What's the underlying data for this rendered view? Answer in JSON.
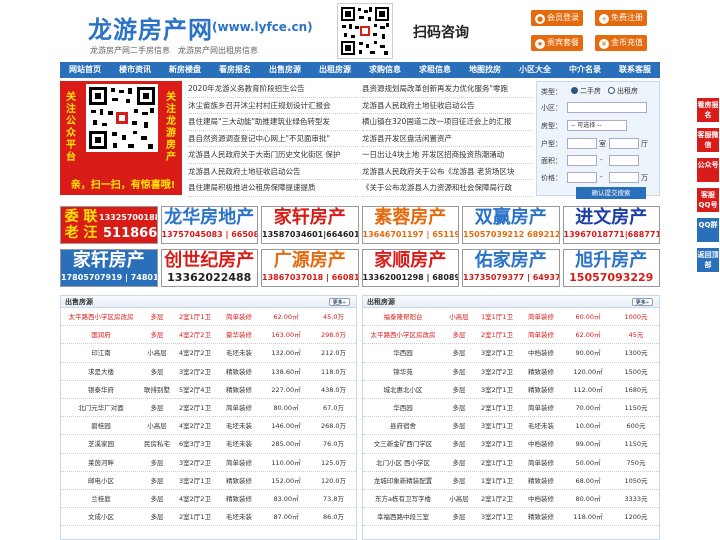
{
  "header": {
    "logo_title": "龙游房产网",
    "logo_url": "(www.lyfce.cn)",
    "logo_sub": "龙游房产网二手房信息　龙游房产网出租房信息",
    "scan_text": "扫码咨询",
    "buttons": [
      "会员登录",
      "免费注册",
      "贵宾套餐",
      "金币充值"
    ]
  },
  "nav": [
    "网站首页",
    "楼市资讯",
    "新房楼盘",
    "看房报名",
    "出售房源",
    "出租房源",
    "求购信息",
    "求租信息",
    "地图找房",
    "小区大全",
    "中介名录",
    "联系客服"
  ],
  "left_qr": {
    "vertical_text": "关注公众平台",
    "vertical_text_right": "关注龙游房产",
    "slogan": "亲，扫一扫，有惊喜哦!"
  },
  "news_left": [
    "2020年龙游义务教育阶段招生公告",
    "沐尘畲族乡召开沐尘村村庄规划设计汇报会",
    "县住建局\"三大动能\"助推建筑业绿色转型发",
    "县自然资源调查登记中心网上\"不见面审批\"",
    "龙游县人民政府关于大南门历史文化街区 保护",
    "龙游县人民政府土地征收启动公告",
    "县住建局积极推进公租房保障提速提质"
  ],
  "news_right": [
    "县资源规划局改革创新再发力优化服务\"零跑",
    "龙游县人民政府土地征收启动公告",
    "横山镇在320国道二改一项目征迁会上的汇报",
    "龙游县开发区盘活闲置资产",
    "一日出让4块土地 开发区招商投资热潮涌动",
    "龙游县人民政府关于公布《龙游县 老货场区块",
    "《关于公布龙游县人力资源和社会保障局行政"
  ],
  "search": {
    "type_label": "类型：",
    "opt1": "二手房",
    "opt2": "出租房",
    "xiaoqu": "小区：",
    "fangxing": "房型：",
    "fangxing_val": "-- 可选择 --",
    "huxing": "户型：",
    "shi": "室",
    "ting": "厅",
    "mianji": "面积：",
    "price": "价格：",
    "unit": "万",
    "submit": "确认提交搜索"
  },
  "ads": [
    {
      "title": "委 联\n老 汪",
      "phone": "13325700188",
      "phone2": "511866"
    },
    {
      "title": "龙华房地产",
      "phone": "13757045083 | 665083"
    },
    {
      "title": "家轩房产",
      "phone": "13587034601|664601"
    },
    {
      "title": "素蓉房产",
      "phone": "13646701197 | 651197"
    },
    {
      "title": "双赢房产",
      "phone": "15057039212 689212"
    },
    {
      "title": "进文房产",
      "phone": "13967018771|688771"
    },
    {
      "title": "家轩房产",
      "phone": "17805707919 | 748019"
    },
    {
      "title": "创世纪房产",
      "phone": "13362022488"
    },
    {
      "title": "广源房产",
      "phone": "13867037018 | 660818"
    },
    {
      "title": "家顺房产",
      "phone": "13362001298 | 680890"
    },
    {
      "title": "佑家房产",
      "phone": "13735079377 | 649377"
    },
    {
      "title": "旭升房产",
      "phone": "15057093229"
    }
  ],
  "sidebar": [
    "看房报名",
    "客服微信",
    "公众号",
    "客服QQ号",
    "QQ群",
    "返回顶部"
  ],
  "sale": {
    "title": "出售房源",
    "more": "更多»",
    "rows": [
      [
        "太平路西小学区房改房",
        "多层",
        "2室1厅1卫",
        "简单装修",
        "62.00㎡",
        "45.0万"
      ],
      [
        "国润府",
        "多层",
        "4室2厅2卫",
        "豪华装修",
        "163.00㎡",
        "298.0万"
      ],
      [
        "印江南",
        "小高层",
        "4室2厅2卫",
        "毛坯未装",
        "132.00㎡",
        "212.0万"
      ],
      [
        "求是大楼",
        "多层",
        "3室2厅2卫",
        "精致装修",
        "138.60㎡",
        "118.0万"
      ],
      [
        "银泰华府",
        "联排别墅",
        "5室2厅4卫",
        "精致装修",
        "227.00㎡",
        "438.0万"
      ],
      [
        "北门元华厂对面",
        "多层",
        "2室2厅1卫",
        "简单装修",
        "80.00㎡",
        "67.0万"
      ],
      [
        "碧桂园",
        "小高层",
        "4室2厅2卫",
        "毛坯未装",
        "146.00㎡",
        "268.0万"
      ],
      [
        "芝溪家园",
        "民房私宅",
        "6室3厅3卫",
        "毛坯未装",
        "285.00㎡",
        "76.0万"
      ],
      [
        "莱茵河畔",
        "多层",
        "3室2厅2卫",
        "简单装修",
        "110.00㎡",
        "125.0万"
      ],
      [
        "邮电小区",
        "多层",
        "3室2厅1卫",
        "精致装修",
        "152.00㎡",
        "120.0万"
      ],
      [
        "兰桂庭",
        "多层",
        "4室2厅2卫",
        "精致装修",
        "83.00㎡",
        "73.8万"
      ],
      [
        "文成小区",
        "多层",
        "2室1厅1卫",
        "毛坯未装",
        "87.00㎡",
        "86.0万"
      ]
    ]
  },
  "rent": {
    "title": "出租房源",
    "more": "更多»",
    "rows": [
      [
        "福泰隆帮阳台",
        "小高层",
        "1室1厅1卫",
        "简单装修",
        "60.00㎡",
        "1000元"
      ],
      [
        "太平路西小学区房改房",
        "多层",
        "2室1厅1卫",
        "简单装修",
        "62.00㎡",
        "45元"
      ],
      [
        "华西园",
        "多层",
        "3室2厅1卫",
        "中档装修",
        "90.00㎡",
        "1300元"
      ],
      [
        "锦华苑",
        "多层",
        "3室2厅2卫",
        "精致装修",
        "120.00㎡",
        "1500元"
      ],
      [
        "城北惠北小区",
        "多层",
        "3室2厅1卫",
        "精致装修",
        "112.00㎡",
        "1680元"
      ],
      [
        "华西园",
        "多层",
        "2室1厅1卫",
        "简单装修",
        "70.00㎡",
        "1150元"
      ],
      [
        "县府宿舍",
        "多层",
        "3室1厅1卫",
        "毛坯未装",
        "10.00㎡",
        "600元"
      ],
      [
        "文三新金矿西门学区",
        "多层",
        "3室2厅1卫",
        "中档装修",
        "99.00㎡",
        "1150元"
      ],
      [
        "北门小区 西小学区",
        "多层",
        "2室1厅1卫",
        "简单装修",
        "50.00㎡",
        "750元"
      ],
      [
        "龙城印象新精装配置",
        "多层",
        "1室1厅1卫",
        "精致装修",
        "68.00㎡",
        "1050元"
      ],
      [
        "东方a栋有卫写字楼",
        "小高层",
        "2室1厅2卫",
        "中档装修",
        "80.00㎡",
        "3333元"
      ],
      [
        "幸福西路中段三室",
        "多层",
        "3室2厅1卫",
        "精致装修",
        "118.00㎡",
        "1200元"
      ]
    ]
  },
  "colors": {
    "brand_blue": "#2a6fba",
    "hot_red": "#d91c18",
    "button_orange": "#e46b0d"
  }
}
